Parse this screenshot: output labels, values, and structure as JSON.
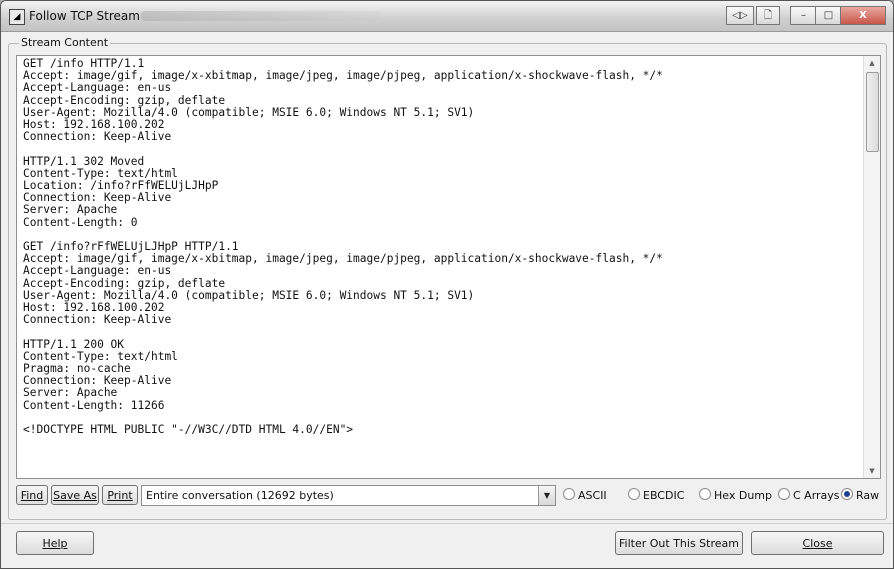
{
  "window": {
    "title": "Follow TCP Stream",
    "icon": "wireshark-app-icon"
  },
  "titlebar_buttons": {
    "extra1": "◁▷",
    "extra2": "🗋",
    "minimize": "–",
    "maximize": "□",
    "close": "X"
  },
  "group": {
    "label": "Stream Content"
  },
  "stream": {
    "lines": [
      "GET /info HTTP/1.1",
      "Accept: image/gif, image/x-xbitmap, image/jpeg, image/pjpeg, application/x-shockwave-flash, */*",
      "Accept-Language: en-us",
      "Accept-Encoding: gzip, deflate",
      "User-Agent: Mozilla/4.0 (compatible; MSIE 6.0; Windows NT 5.1; SV1)",
      "Host: 192.168.100.202",
      "Connection: Keep-Alive",
      "",
      "HTTP/1.1 302 Moved",
      "Content-Type: text/html",
      "Location: /info?rFfWELUjLJHpP",
      "Connection: Keep-Alive",
      "Server: Apache",
      "Content-Length: 0",
      "",
      "GET /info?rFfWELUjLJHpP HTTP/1.1",
      "Accept: image/gif, image/x-xbitmap, image/jpeg, image/pjpeg, application/x-shockwave-flash, */*",
      "Accept-Language: en-us",
      "Accept-Encoding: gzip, deflate",
      "User-Agent: Mozilla/4.0 (compatible; MSIE 6.0; Windows NT 5.1; SV1)",
      "Host: 192.168.100.202",
      "Connection: Keep-Alive",
      "",
      "HTTP/1.1 200 OK",
      "Content-Type: text/html",
      "Pragma: no-cache",
      "Connection: Keep-Alive",
      "Server: Apache",
      "Content-Length: 11266",
      "",
      "<!DOCTYPE HTML PUBLIC \"-//W3C//DTD HTML 4.0//EN\">"
    ]
  },
  "controls": {
    "find_label": "Find",
    "save_as_label": "Save As",
    "print_label": "Print",
    "conversation_select": "Entire conversation (12692 bytes)",
    "format_options": [
      "ASCII",
      "EBCDIC",
      "Hex Dump",
      "C Arrays",
      "Raw"
    ],
    "selected_format": "Raw"
  },
  "footer": {
    "help_label": "Help",
    "filter_label": "Filter Out This Stream",
    "close_label": "Close"
  }
}
